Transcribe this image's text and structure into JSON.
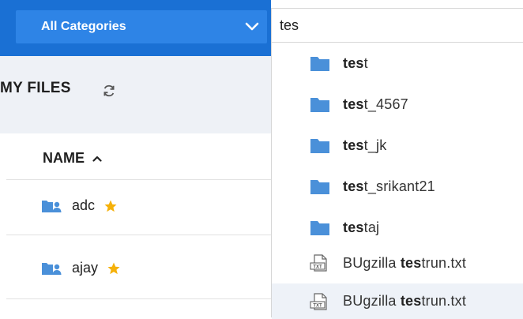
{
  "category_select": {
    "label": "All Categories"
  },
  "my_files": {
    "title": "MY FILES"
  },
  "table": {
    "name_header": "NAME",
    "rows": [
      {
        "name": "adc",
        "starred": true
      },
      {
        "name": "ajay",
        "starred": true
      }
    ]
  },
  "search": {
    "query": "tes"
  },
  "results": [
    {
      "type": "folder",
      "match": "tes",
      "rest": "t"
    },
    {
      "type": "folder",
      "match": "tes",
      "rest": "t_4567"
    },
    {
      "type": "folder",
      "match": "tes",
      "rest": "t_jk"
    },
    {
      "type": "folder",
      "match": "tes",
      "rest": "t_srikant21"
    },
    {
      "type": "folder",
      "match": "tes",
      "rest": "taj"
    },
    {
      "type": "file",
      "prefix": "BUgzilla ",
      "match": "tes",
      "rest": "trun.txt"
    },
    {
      "type": "file",
      "prefix": "BUgzilla ",
      "match": "tes",
      "rest": "trun.txt"
    }
  ],
  "icons": {
    "chevron": "chevron-down-icon",
    "refresh": "refresh-icon",
    "sort": "sort-ascending-icon",
    "shared_folder": "shared-folder-icon",
    "star": "star-icon",
    "folder": "folder-icon",
    "txt": "txt-file-icon"
  },
  "colors": {
    "brand_blue": "#1a70d4",
    "select_blue": "#2e84e6",
    "folder_blue": "#4a90d9",
    "star_gold": "#f5b10a",
    "hover_bg": "#eef2f8"
  }
}
